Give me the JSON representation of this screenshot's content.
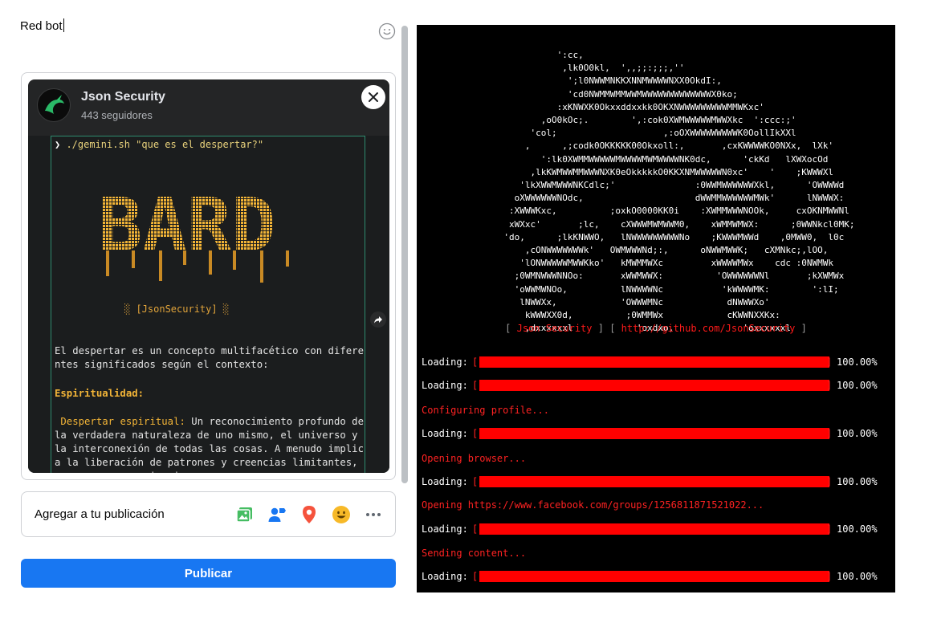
{
  "composer": {
    "text": "Red bot",
    "emoji_icon": "smiley-face-icon"
  },
  "shared_post": {
    "page_name": "Json Security",
    "followers": "443 seguidores",
    "avatar_icon": "kali-dragon-logo",
    "close_icon": "close-icon",
    "share_icon": "share-arrow-icon",
    "screenshot": {
      "prompt": "❯",
      "command": " ./gemini.sh \"que es el despertar?\"",
      "logo_text": "BARD",
      "tag": "░ [JsonSecurity] ░",
      "para1": "El despertar es un concepto multifacético con diferentes significados según el contexto:",
      "heading": "Espiritualidad:",
      "para2_highlight": " Despertar espiritual:",
      "para2": " Un reconocimiento profundo de la verdadera naturaleza de uno mismo, el universo y la interconexión de todas las cosas. A menudo implica la liberación de patrones y creencias limitantes, y una mayor conciencia y ac"
    }
  },
  "add_to_post": {
    "label": "Agregar a tu publicación",
    "icons": [
      "photo-video-icon",
      "tag-people-icon",
      "location-pin-icon",
      "feeling-emoji-icon",
      "more-options-icon"
    ]
  },
  "publish": {
    "label": "Publicar"
  },
  "terminal": {
    "ascii_art": "                 ':cc,\n                  ,lk0O0kl,  ',,;;:;;;,''\n                   ';l0NWWMNKKXNNMWWWWNXX0OkdI:,\n                   'cd0NWMMWMMWWMWWWWWWWWWWWWWX0ko;\n                 :xKNWXK0Okxxddxxkk0OKXNWWWWWWWWWMMWKxc'\n              ,oO0kOc;.        ',:cok0XWMWWWWWMWWXkc  ':ccc:;'\n            'col;                    ,:oOXWWWWWWWWWK0OollIkXXl\n           ,      ,;codk0OKKKKK00Okxoll:,       ,cxKWWWWKO0NXx,  lXk'\n              ':lk0XWMMWWWWWMWWWWMWMWWWWNK0dc,      'ckKd   lXWXocOd\n            ,lkKWMWWMMWWWNXK0eOkkkkkO0KKXNMWWWWWN0xc'    '    ;KWWWXl\n          'lkXWWMWWWNKCdlc;'               :0WWMWWWWWWXkl,      'OWWWWd\n         oXWWWWWWNOdc,                     dWWMMWWWWWWMWk'      lNWWWX:\n        :XWWWKxc,          ;oxkO0000KK0i    :XWMMWWWNOOk,     cxOKNMWWNl\n        xWXxc'       ;lc,    cXWWWMWMWWM0,    xWMMWMWX:      ;0WWNkcl0MK;\n       'do,      ;lkKNWWO,   lNWWWWWWWWWNo    ;KWWWMWWd    ,0MWW0,  l0c\n           ,cONWWWWWWWk'   OWMWWWNd;:,      oNWWMWWK;   cXMNkc;,lOO,\n          'lONWWWWWMWWKko'   kMWMMWXc         xWWWWMWx    cdc :0NWMWk\n         ;0WMNWWWNNOo:       xWWMWWX:          'OWWWWWWNl       ;kXWMWx\n         'oWWMWNOo,          lNWWWWNc           'kWWWWMK:        ':lI;\n          lNWWXx,            'OWWWMNc            dNWWWXo'\n           kWWWXX0d,          ;0WMMWx            cKWWNXXKx:\n           ,dxxxxxxl            'oxdxo,             'oxxxxxxl",
    "banner_open": "[ ",
    "banner_name": "Json Security",
    "banner_mid": " ] [ ",
    "banner_url": "http://github.com/JsonSecurity",
    "banner_close": " ]",
    "lines": [
      {
        "kind": "loading",
        "label": "Loading:",
        "bar_fraction": 1.0,
        "percent": "100.00%"
      },
      {
        "kind": "loading",
        "label": "Loading:",
        "bar_fraction": 1.0,
        "percent": "100.00%"
      },
      {
        "kind": "status",
        "text": "Configuring profile..."
      },
      {
        "kind": "loading",
        "label": "Loading:",
        "bar_fraction": 1.0,
        "percent": "100.00%"
      },
      {
        "kind": "status",
        "text": "Opening browser..."
      },
      {
        "kind": "loading",
        "label": "Loading:",
        "bar_fraction": 1.0,
        "percent": "100.00%"
      },
      {
        "kind": "status",
        "text": "Opening https://www.facebook.com/groups/1256811871521022..."
      },
      {
        "kind": "loading",
        "label": "Loading:",
        "bar_fraction": 1.0,
        "percent": "100.00%"
      },
      {
        "kind": "status",
        "text": "Sending content..."
      },
      {
        "kind": "loading",
        "label": "Loading:",
        "bar_fraction": 1.0,
        "percent": "100.00%"
      }
    ]
  },
  "colors": {
    "publish_blue": "#1877f2",
    "terminal_red": "#ff0000",
    "bard_yellow": "#f2b437"
  }
}
